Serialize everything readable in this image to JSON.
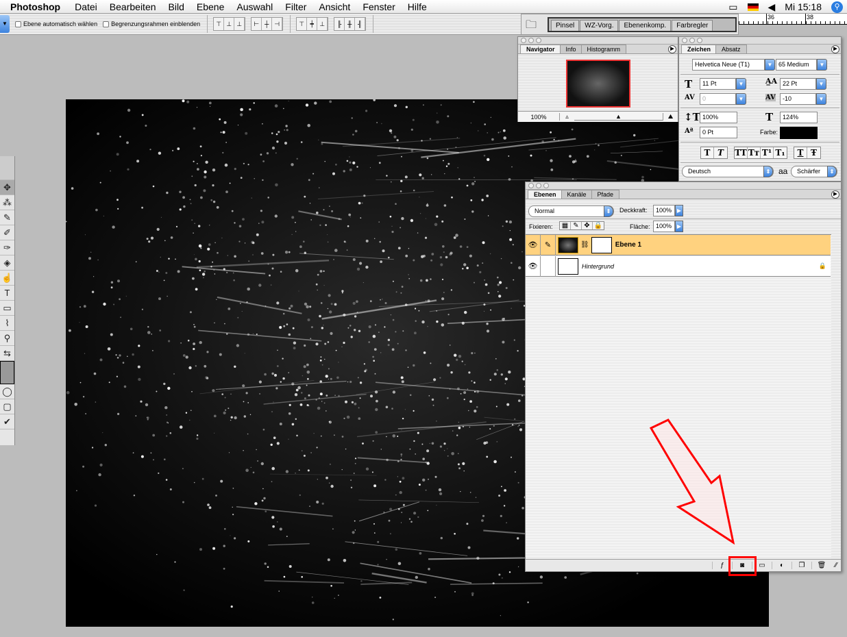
{
  "menubar": {
    "app": "Photoshop",
    "items": [
      "Datei",
      "Bearbeiten",
      "Bild",
      "Ebene",
      "Auswahl",
      "Filter",
      "Ansicht",
      "Fenster",
      "Hilfe"
    ],
    "clock": "Mi 15:18",
    "icons": [
      "display-icon",
      "german-flag-icon",
      "volume-icon",
      "spotlight-icon"
    ]
  },
  "options": {
    "auto_select": "Ebene automatisch wählen",
    "bounding_box": "Begrenzungsrahmen einblenden",
    "auto_select_checked": false,
    "bounding_box_checked": false
  },
  "well": {
    "tabs": [
      "Pinsel",
      "WZ-Vorg.",
      "Ebenenkomp.",
      "Farbregler"
    ]
  },
  "ruler": {
    "labels": [
      "36",
      "38"
    ]
  },
  "navigator": {
    "tabs": [
      "Navigator",
      "Info",
      "Histogramm"
    ],
    "zoom": "100%"
  },
  "zeichen": {
    "tabs": [
      "Zeichen",
      "Absatz"
    ],
    "font": "Helvetica Neue (T1)",
    "style": "65 Medium",
    "size": "11 Pt",
    "leading": "22 Pt",
    "kerning": "0",
    "tracking": "-10",
    "vscale": "100%",
    "hscale": "124%",
    "baseline": "0 Pt",
    "color_label": "Farbe:",
    "color": "#000000",
    "style_buttons": [
      "T",
      "T",
      "TT",
      "Tт",
      "T¹",
      "T₁",
      "T",
      "Ŧ"
    ],
    "language": "Deutsch",
    "antialias": "Schärfer"
  },
  "ebenen": {
    "tabs": [
      "Ebenen",
      "Kanäle",
      "Pfade"
    ],
    "blend": "Normal",
    "opacity_label": "Deckkraft:",
    "opacity": "100%",
    "lock_label": "Fixieren:",
    "fill_label": "Fläche:",
    "fill": "100%",
    "layers": [
      {
        "name": "Ebene 1",
        "selected": true,
        "visible": true,
        "has_mask": true
      },
      {
        "name": "Hintergrund",
        "selected": false,
        "visible": true,
        "locked": true
      }
    ],
    "footer": [
      "layer-style-icon",
      "add-mask-icon",
      "new-group-icon",
      "adjustment-layer-icon",
      "new-layer-icon",
      "trash-icon"
    ],
    "highlight_color": "#ff0000",
    "selected_color": "#ffd27f"
  }
}
